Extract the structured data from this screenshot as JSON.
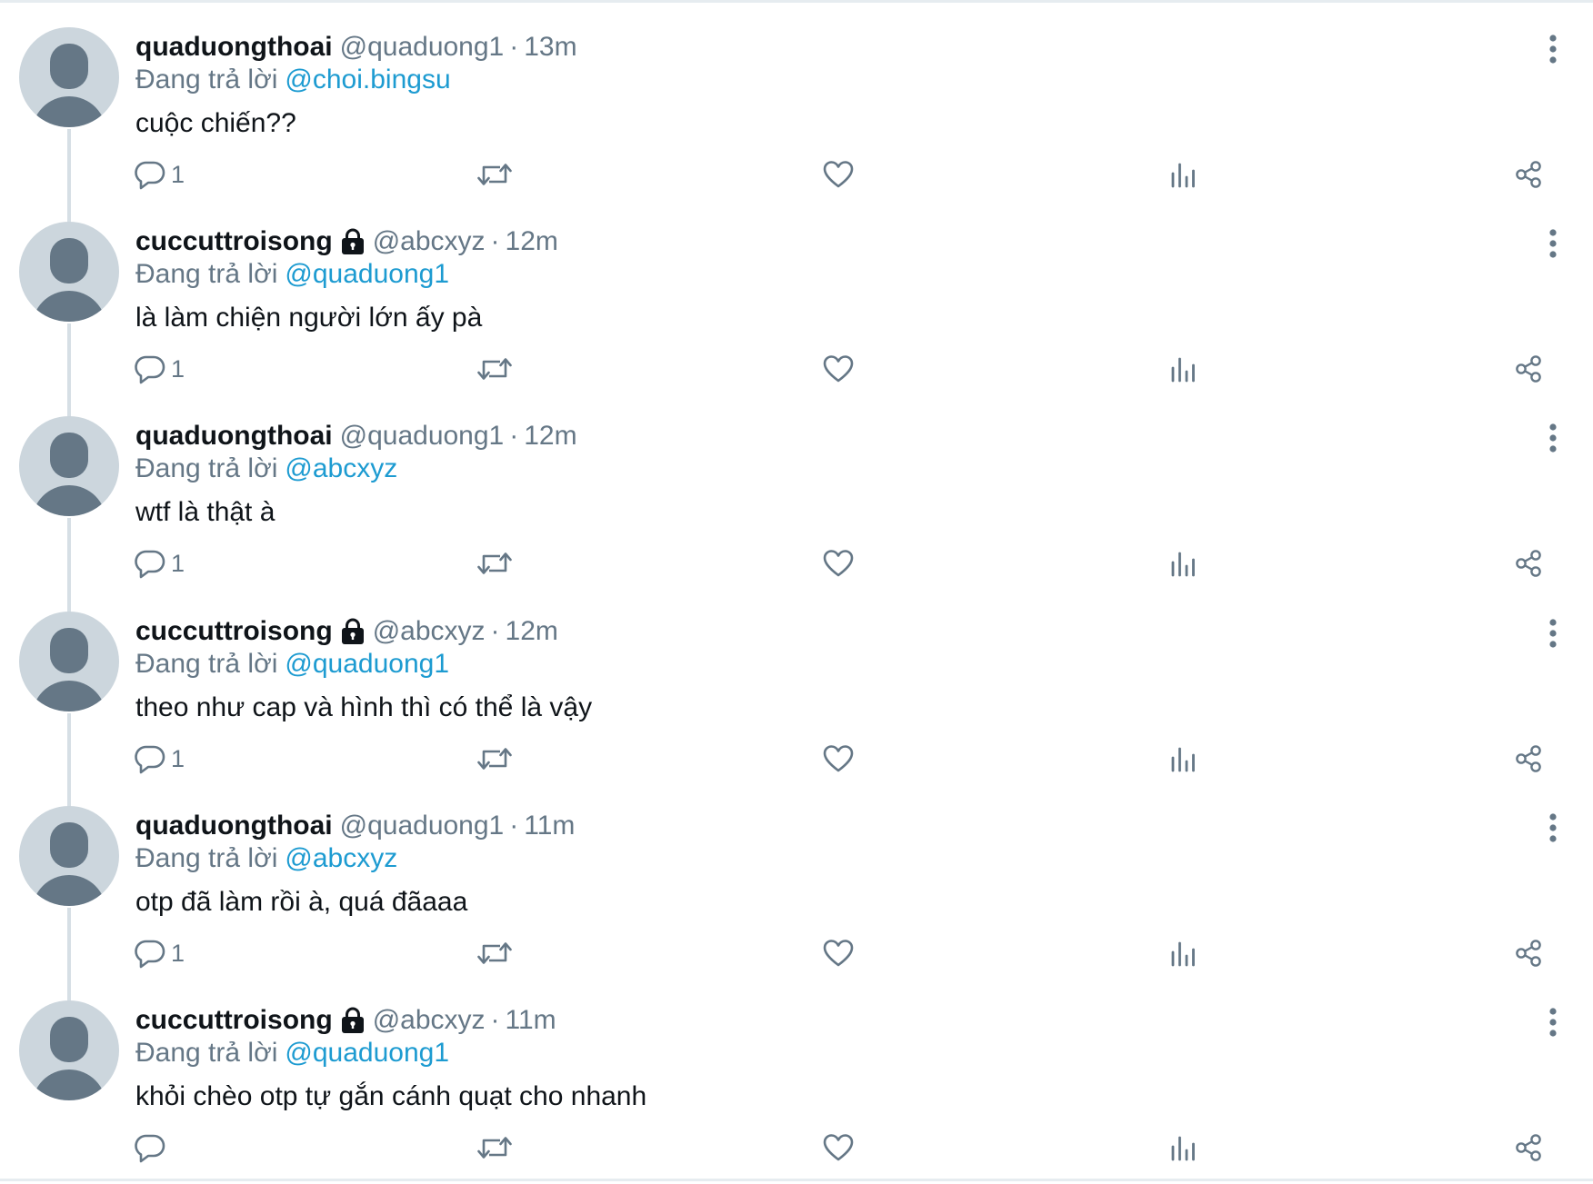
{
  "tweets": [
    {
      "display_name": "quaduongthoai",
      "locked": false,
      "handle": "@quaduong1",
      "time": "13m",
      "reply_prefix": "Đang trả lời",
      "reply_to": "@choi.bingsu",
      "text": "cuộc chiến??",
      "reply_count": "1"
    },
    {
      "display_name": "cuccuttroisong",
      "locked": true,
      "handle": "@abcxyz",
      "time": "12m",
      "reply_prefix": "Đang trả lời",
      "reply_to": "@quaduong1",
      "text": "là làm chiện người lớn ấy pà",
      "reply_count": "1"
    },
    {
      "display_name": "quaduongthoai",
      "locked": false,
      "handle": "@quaduong1",
      "time": "12m",
      "reply_prefix": "Đang trả lời",
      "reply_to": "@abcxyz",
      "text": "wtf là thật à",
      "reply_count": "1"
    },
    {
      "display_name": "cuccuttroisong",
      "locked": true,
      "handle": "@abcxyz",
      "time": "12m",
      "reply_prefix": "Đang trả lời",
      "reply_to": "@quaduong1",
      "text": "theo như cap và hình thì có thể là vậy",
      "reply_count": "1"
    },
    {
      "display_name": "quaduongthoai",
      "locked": false,
      "handle": "@quaduong1",
      "time": "11m",
      "reply_prefix": "Đang trả lời",
      "reply_to": "@abcxyz",
      "text": "otp đã làm rồi à, quá đãaaa",
      "reply_count": "1"
    },
    {
      "display_name": "cuccuttroisong",
      "locked": true,
      "handle": "@abcxyz",
      "time": "11m",
      "reply_prefix": "Đang trả lời",
      "reply_to": "@quaduong1",
      "text": "khỏi chèo otp tự gắn cánh quạt cho nhanh",
      "reply_count": ""
    }
  ],
  "separator": "·",
  "colors": {
    "text_primary": "#0f1419",
    "text_secondary": "#657786",
    "link": "#1d9bd1",
    "avatar_bg": "#ccd6dd",
    "avatar_fg": "#657786",
    "thread_line": "#d6dfe5"
  },
  "icons": {
    "reply": "speech-bubble-icon",
    "retweet": "retweet-arrows-icon",
    "like": "heart-icon",
    "stats": "bar-chart-icon",
    "share": "share-nodes-icon",
    "more": "vertical-dots-icon",
    "lock": "lock-icon",
    "avatar": "default-avatar-icon"
  }
}
